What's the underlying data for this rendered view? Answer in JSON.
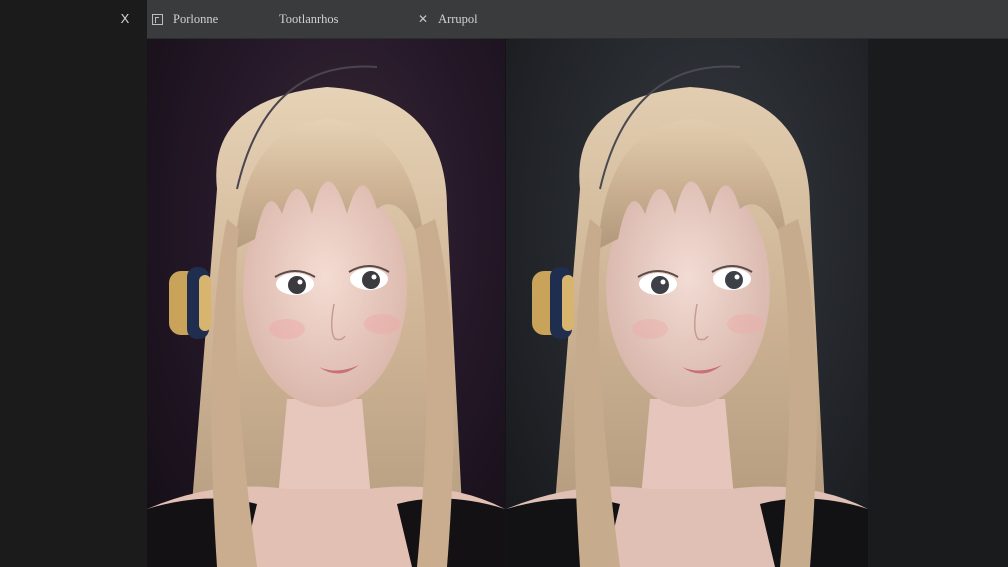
{
  "window": {
    "close_label": "X"
  },
  "tabs": [
    {
      "label": "Porlonne",
      "icon": "frame-icon"
    },
    {
      "label": "Tootlanrhos",
      "icon": ""
    },
    {
      "label": "Arrupol",
      "icon": "close-icon"
    }
  ],
  "canvas": {
    "images": [
      {
        "name": "portrait-left",
        "background": "#26192a"
      },
      {
        "name": "portrait-right",
        "background": "#25282d"
      }
    ]
  },
  "colors": {
    "topbar": "#3a3b3d",
    "panel": "#1b1b1c",
    "text": "#d2d2d2",
    "hair": "#d9c3a6"
  }
}
